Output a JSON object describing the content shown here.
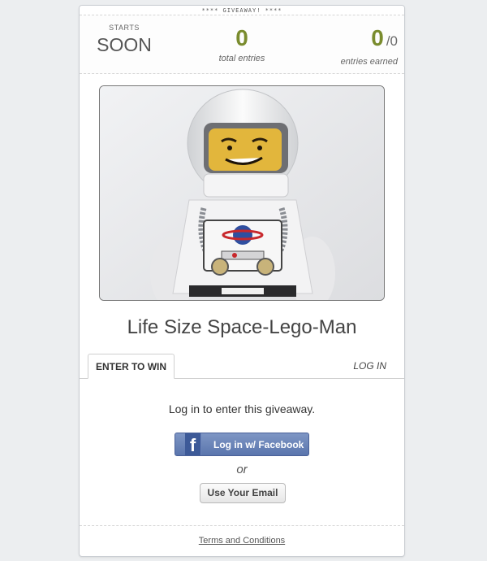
{
  "header": {
    "strip_text": "**** GIVEAWAY! ****"
  },
  "stats": {
    "starts_label": "STARTS",
    "starts_value": "SOON",
    "total_entries": "0",
    "total_entries_caption": "total entries",
    "entries_earned": "0",
    "entries_earned_denominator": "/0",
    "entries_earned_caption": "entries earned"
  },
  "prize": {
    "image_description_icon": "lego-spaceman-photo",
    "title": "Life Size Space-Lego-Man"
  },
  "tabs": {
    "enter": "ENTER TO WIN",
    "login": "LOG IN"
  },
  "entry": {
    "prompt": "Log in to enter this giveaway.",
    "facebook_icon": "f",
    "facebook_label": "Log in w/ Facebook",
    "or_text": "or",
    "email_label": "Use Your Email"
  },
  "footer": {
    "terms": "Terms and Conditions"
  },
  "colors": {
    "accent_green": "#7a8c2e",
    "facebook_blue": "#5a75ad"
  }
}
